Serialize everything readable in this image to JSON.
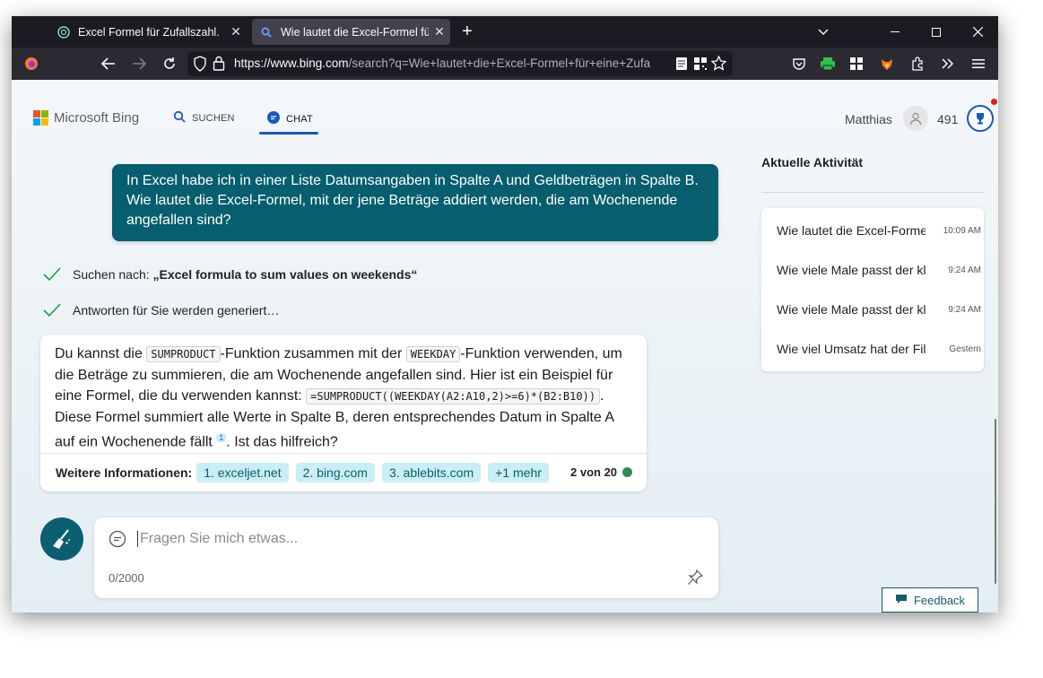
{
  "browser": {
    "tabs": [
      {
        "title": "Excel Formel für Zufallszahl.",
        "active": false
      },
      {
        "title": "Wie lautet die Excel-Formel für",
        "active": true
      }
    ],
    "url": {
      "base": "https://www.bing.com",
      "rest": "/search?q=Wie+lautet+die+Excel-Formel+für+eine+Zufa"
    }
  },
  "header": {
    "brand": "Microsoft Bing",
    "nav": {
      "search": "SUCHEN",
      "chat": "CHAT"
    },
    "user_name": "Matthias",
    "points": "491"
  },
  "conversation": {
    "user_message": "In Excel habe ich in einer Liste Datumsangaben in Spalte A und Geldbeträgen in Spalte B. Wie lautet die Excel-Formel, mit der jene Beträge addiert werden, die am Wochenende angefallen sind?",
    "status_search_prefix": "Suchen nach: ",
    "status_search_query": "„Excel formula to sum values on weekends“",
    "status_generating": "Antworten für Sie werden generiert…",
    "answer": {
      "t1": "Du kannst die ",
      "code1": "SUMPRODUCT",
      "t2": "-Funktion zusammen mit der ",
      "code2": "WEEKDAY",
      "t3": "-Funktion verwenden, um die Beträge zu summieren, die am Wochenende angefallen sind. Hier ist ein Beispiel für eine Formel, die du verwenden kannst: ",
      "code3": "=SUMPRODUCT((WEEKDAY(A2:A10,2)>=6)*(B2:B10))",
      "t4": ". Diese Formel summiert alle Werte in Spalte B, deren entsprechendes Datum in Spalte A auf ein Wochenende fällt",
      "cite": "1",
      "t5": ". Ist das hilfreich?"
    },
    "more_label": "Weitere Informationen:",
    "sources": [
      "1. exceljet.net",
      "2. bing.com",
      "3. ablebits.com",
      "+1 mehr"
    ],
    "turn_count": "2 von 20"
  },
  "input": {
    "placeholder": "Fragen Sie mich etwas...",
    "counter": "0/2000"
  },
  "activity": {
    "title": "Aktuelle Aktivität",
    "items": [
      {
        "title": "Wie lautet die Excel-Formel für",
        "time": "10:09 AM"
      },
      {
        "title": "Wie viele Male passt der kleine",
        "time": "9:24 AM"
      },
      {
        "title": "Wie viele Male passt der kleine",
        "time": "9:24 AM"
      },
      {
        "title": "Wie viel Umsatz hat der Film",
        "time": "Gestern"
      }
    ]
  },
  "feedback_label": "Feedback",
  "colors": {
    "accent": "#1a56c6",
    "bubble": "#065e6e",
    "chip": "#c9eef6",
    "ok_green": "#2e8b57"
  }
}
